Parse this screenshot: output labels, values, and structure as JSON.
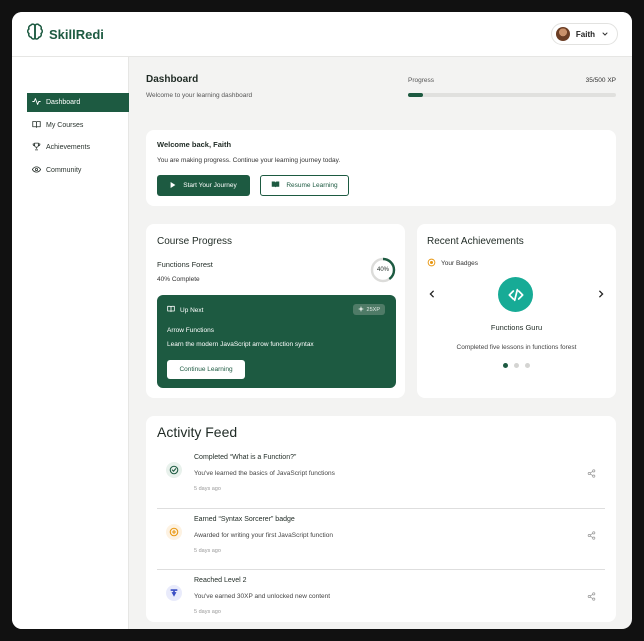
{
  "app": {
    "brand": "SkillRedi",
    "brand_part1": "Skill",
    "brand_part2": "Redi"
  },
  "user": {
    "name": "Faith"
  },
  "sidebar": {
    "items": [
      {
        "label": "Dashboard",
        "icon": "activity-icon",
        "active": true
      },
      {
        "label": "My Courses",
        "icon": "book-open-icon",
        "active": false
      },
      {
        "label": "Achievements",
        "icon": "trophy-icon",
        "active": false
      },
      {
        "label": "Community",
        "icon": "eye-icon",
        "active": false
      }
    ]
  },
  "header": {
    "title": "Dashboard",
    "subtitle": "Welcome to your learning dashboard",
    "progress_label": "Progress",
    "progress_value": "35/500 XP",
    "progress_fraction": 0.07
  },
  "welcome": {
    "title": "Welcome back, Faith",
    "text": "You are making progress. Continue your learning journey today.",
    "primary_button": "Start Your Journey",
    "secondary_button": "Resume Learning"
  },
  "course_progress": {
    "title": "Course Progress",
    "course_name": "Functions Forest",
    "complete_text": "40% Complete",
    "percent_label": "40%",
    "percent": 40,
    "up_next": {
      "label": "Up Next",
      "xp": "25XP",
      "lesson_title": "Arrow Functions",
      "lesson_desc": "Learn the modern JavaScript arrow function syntax",
      "button": "Continue Learning"
    }
  },
  "achievements": {
    "title": "Recent Achievements",
    "badges_label": "Your Badges",
    "badge_name": "Functions Guru",
    "badge_desc": "Completed five lessons in functions forest",
    "carousel_pages": 3,
    "carousel_active": 0
  },
  "activity": {
    "title": "Activity Feed",
    "items": [
      {
        "title": "Completed “What is a Function?”",
        "desc": "You've learned the basics of JavaScript functions",
        "time": "5 days ago",
        "icon": "check-circle-icon",
        "icon_color": "#1d5a41",
        "icon_bg": "#e8f1ec"
      },
      {
        "title": "Earned “Syntax Sorcerer” badge",
        "desc": "Awarded for writing your first JavaScript function",
        "time": "5 days ago",
        "icon": "award-icon",
        "icon_color": "#e8960f",
        "icon_bg": "#fdf2e2"
      },
      {
        "title": "Reached Level 2",
        "desc": "You've earned 30XP and unlocked new content",
        "time": "5 days ago",
        "icon": "level-up-icon",
        "icon_color": "#3b4fc4",
        "icon_bg": "#e9ebfb"
      }
    ]
  },
  "colors": {
    "primary": "#1d5a41",
    "badge": "#17ab96",
    "background": "#f3f3f2"
  }
}
